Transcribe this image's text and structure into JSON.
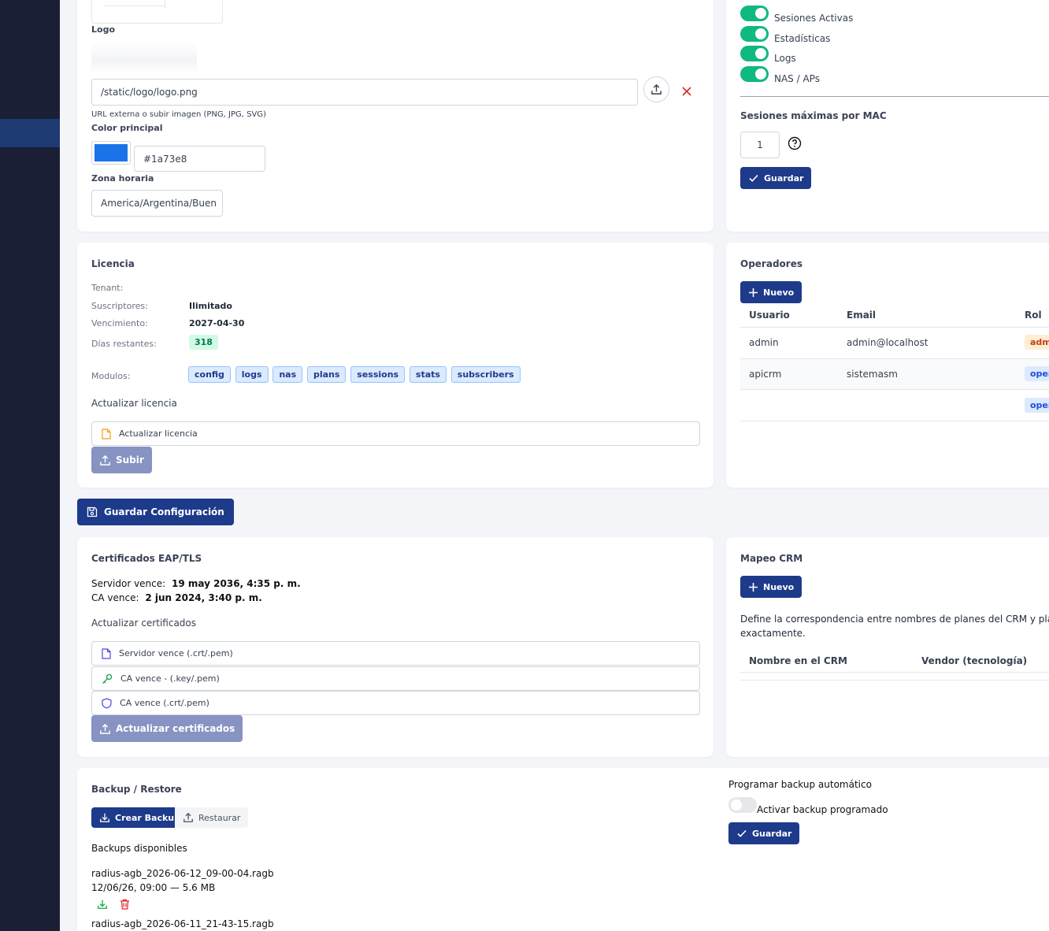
{
  "branding": {
    "logo_label": "Logo",
    "logo_url": "/static/logo/logo.png",
    "logo_hint": "URL externa o subir imagen (PNG, JPG, SVG)",
    "color_label": "Color principal",
    "color_value": "#1a73e8",
    "timezone_label": "Zona horaria",
    "timezone_value": "America/Argentina/Buen"
  },
  "modules_toggles": [
    {
      "label": "Sesiones Activas",
      "on": true
    },
    {
      "label": "Estadísticas",
      "on": true
    },
    {
      "label": "Logs",
      "on": true
    },
    {
      "label": "NAS / APs",
      "on": true
    }
  ],
  "sessions": {
    "label": "Sesiones máximas por MAC",
    "value": "1",
    "save_label": "Guardar"
  },
  "license": {
    "title": "Licencia",
    "tenant_label": "Tenant:",
    "subscribers_label": "Suscriptores:",
    "subscribers_value": "Ilimitado",
    "expiry_label": "Vencimiento:",
    "expiry_value": "2027-04-30",
    "days_label": "Días restantes:",
    "days_value": "318",
    "modules_label": "Modulos:",
    "modules": [
      "config",
      "logs",
      "nas",
      "plans",
      "sessions",
      "stats",
      "subscribers"
    ],
    "update_title": "Actualizar licencia",
    "file_placeholder": "Actualizar licencia",
    "submit_label": "Subir"
  },
  "operators": {
    "title": "Operadores",
    "new_label": "Nuevo",
    "headers": [
      "Usuario",
      "Email",
      "Rol"
    ],
    "rows": [
      {
        "user": "admin",
        "email": "admin@localhost",
        "role": "adm"
      },
      {
        "user": "apicrm",
        "email": "sistemasm",
        "role": "oper"
      },
      {
        "user": "",
        "email": "",
        "role": "oper"
      }
    ]
  },
  "save_config_label": "Guardar Configuración",
  "certs": {
    "title": "Certificados EAP/TLS",
    "server_label": "Servidor vence:",
    "server_value": "19 may 2036, 4:35 p. m.",
    "ca_label": "CA vence:",
    "ca_value": "2 jun 2024, 3:40 p. m.",
    "update_title": "Actualizar certificados",
    "files": [
      "Servidor vence (.crt/.pem)",
      "CA vence - (.key/.pem)",
      "CA vence (.crt/.pem)"
    ],
    "submit_label": "Actualizar certificados"
  },
  "crm": {
    "title": "Mapeo CRM",
    "new_label": "Nuevo",
    "description_1": "Define la correspondencia entre nombres de planes del CRM y plan",
    "description_2": "exactamente.",
    "headers": [
      "Nombre en el CRM",
      "Vendor (tecnología)"
    ]
  },
  "backup": {
    "title": "Backup / Restore",
    "create_label": "Crear Backup",
    "restore_label": "Restaurar",
    "available_label": "Backups disponibles",
    "items": [
      {
        "name": "radius-agb_2026-06-12_09-00-04.ragb",
        "meta": "12/06/26, 09:00 — 5.6 MB"
      },
      {
        "name": "radius-agb_2026-06-11_21-43-15.ragb",
        "meta": ""
      }
    ],
    "schedule_title": "Programar backup automático",
    "schedule_toggle_label": "Activar backup programado",
    "schedule_save_label": "Guardar"
  },
  "colors": {
    "primary": "#1e3a8a",
    "toggle_on": "#10b981",
    "danger": "#dc2626",
    "badge_admin": "#c2410c",
    "badge_oper": "#1d4ed8"
  }
}
